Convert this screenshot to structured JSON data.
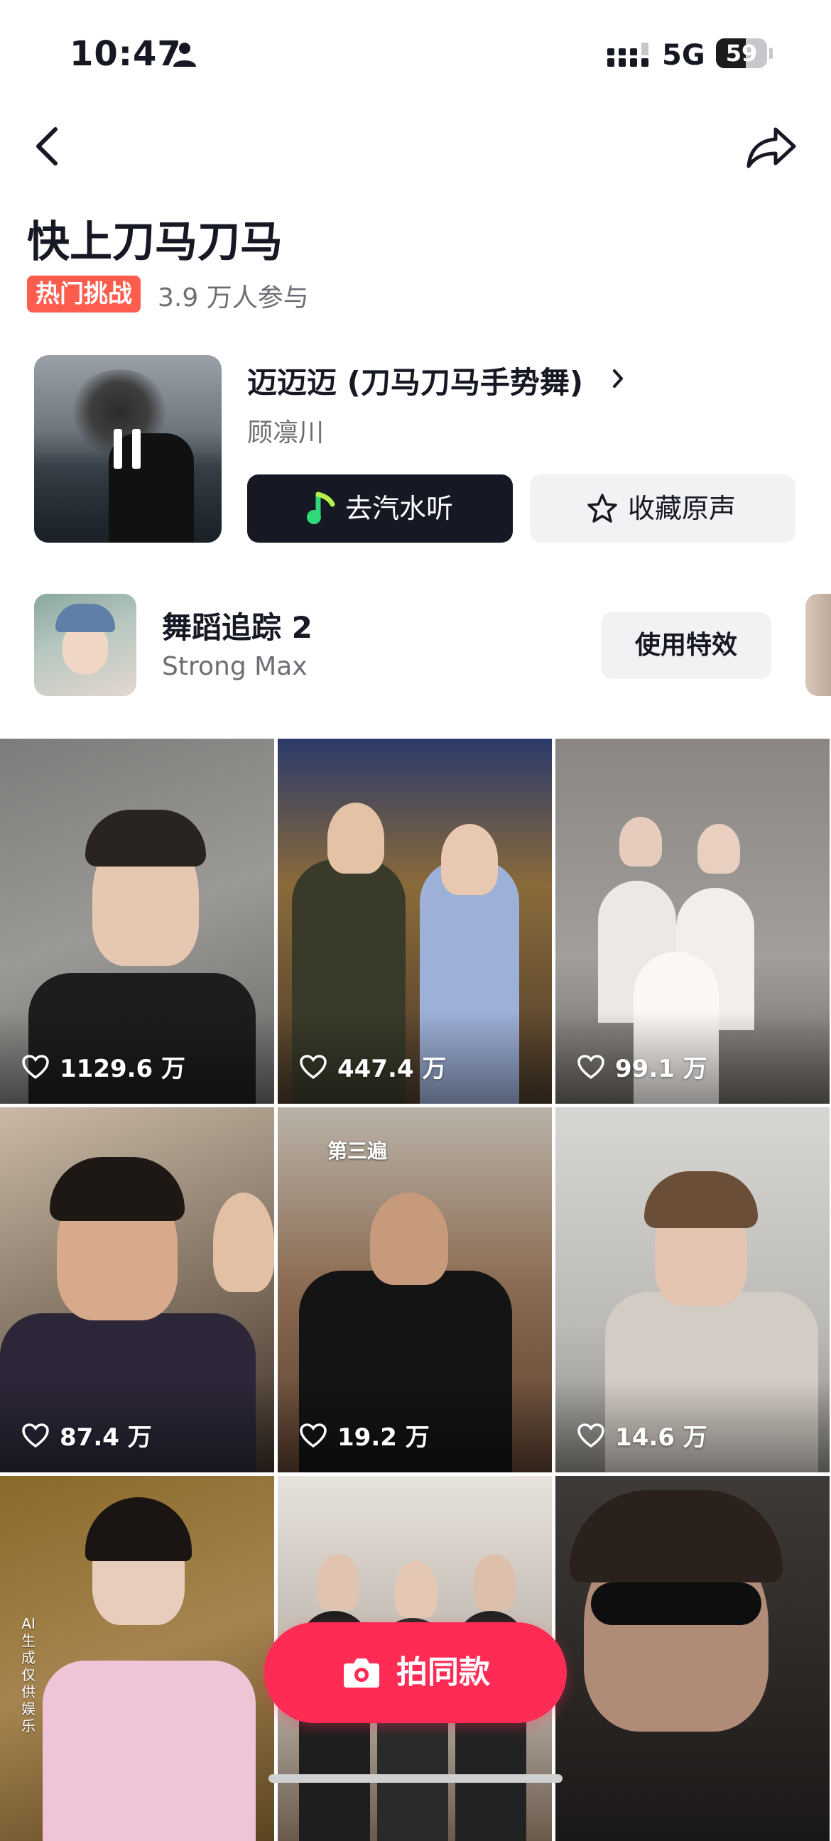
{
  "status_bar": {
    "time": "10:47",
    "network": "5G",
    "battery": "59"
  },
  "header": {
    "title": "快上刀马刀马",
    "badge": "热门挑战",
    "participants": "3.9 万人参与"
  },
  "music": {
    "song_title": "迈迈迈 (刀马刀马手势舞)",
    "artist": "顾凛川",
    "listen_button": "去汽水听",
    "favorite_button": "收藏原声"
  },
  "effect": {
    "title": "舞蹈追踪 2",
    "author": "Strong Max",
    "use_button": "使用特效"
  },
  "videos": [
    {
      "likes": "1129.6 万"
    },
    {
      "likes": "447.4 万"
    },
    {
      "likes": "99.1 万"
    },
    {
      "likes": "87.4 万"
    },
    {
      "likes": "19.2 万",
      "overlay": "第三遍"
    },
    {
      "likes": "14.6 万"
    },
    {
      "ai_tag": "AI生成 仅供娱乐"
    },
    {},
    {}
  ],
  "shoot_button": "拍同款",
  "colors": {
    "accent": "#fe2c55",
    "badge": "#fe5c4d",
    "dark_button": "#161823",
    "light_button": "#f2f2f4"
  },
  "icons": [
    "person-icon",
    "signal-icon",
    "battery-icon",
    "back-icon",
    "share-icon",
    "pause-icon",
    "chevron-right-icon",
    "music-icon",
    "star-icon",
    "heart-icon",
    "camera-icon"
  ]
}
